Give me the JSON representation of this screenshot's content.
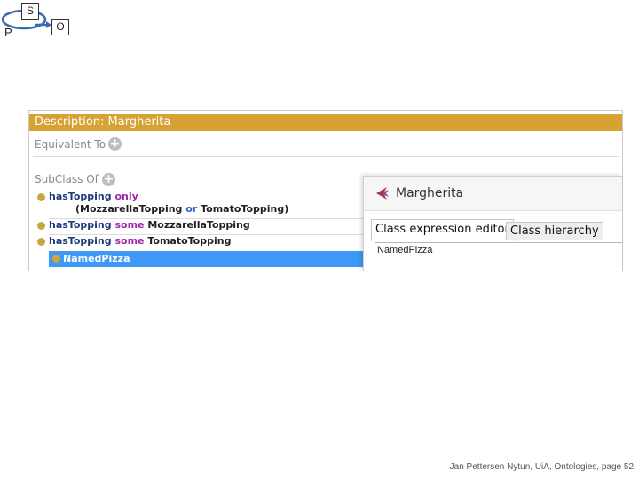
{
  "logo": {
    "subject": "S",
    "predicate": "P",
    "object": "O"
  },
  "description": {
    "title": "Description: Margherita",
    "equivalent_label": "Equivalent To",
    "subclass_label": "SubClass Of",
    "axioms": [
      {
        "prop": "hasTopping",
        "kw": "only"
      },
      {
        "line2_open": "(",
        "cls_a": "MozzarellaTopping",
        "kw": "or",
        "cls_b": "TomatoTopping",
        "line2_close": ")"
      },
      {
        "prop": "hasTopping",
        "kw": "some",
        "cls": "MozzarellaTopping"
      },
      {
        "prop": "hasTopping",
        "kw": "some",
        "cls": "TomatoTopping"
      }
    ],
    "selected": "NamedPizza"
  },
  "editor": {
    "title": "Margherita",
    "tabs": [
      "Class expression editor",
      "Class hierarchy"
    ],
    "value": "NamedPizza"
  },
  "footer": "Jan Pettersen Nytun, UiA, Ontologies, page 52"
}
